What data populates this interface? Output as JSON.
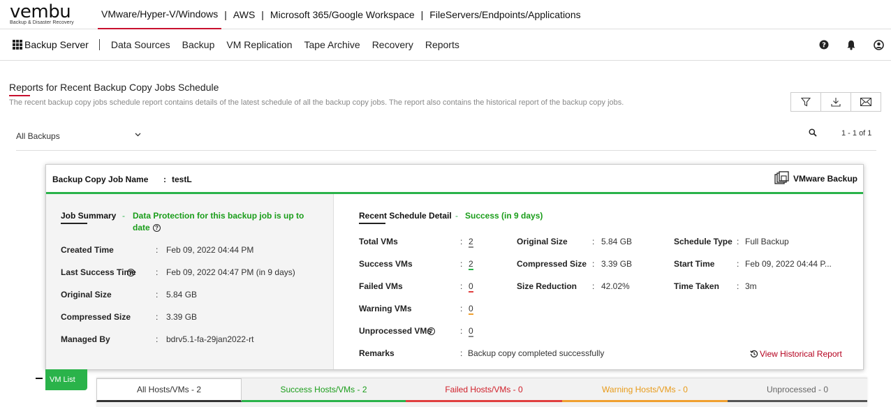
{
  "brand": {
    "name": "vembu",
    "tagline": "Backup & Disaster Recovery"
  },
  "product_tabs": [
    "VMware/Hyper-V/Windows",
    "AWS",
    "Microsoft 365/Google Workspace",
    "FileServers/Endpoints/Applications"
  ],
  "product_separator": "|",
  "nav": {
    "server": "Backup Server",
    "items": [
      "Data Sources",
      "Backup",
      "VM Replication",
      "Tape Archive",
      "Recovery",
      "Reports"
    ]
  },
  "page": {
    "title": "Reports for Recent Backup Copy Jobs Schedule",
    "description": "The recent backup copy jobs schedule report contains details of the latest schedule of all the backup copy jobs. The report also contains the historical report of the backup copy jobs."
  },
  "filter": {
    "selected": "All Backups",
    "paging": "1 - 1 of 1"
  },
  "job": {
    "name_label": "Backup Copy Job Name",
    "name_colon": ":",
    "name_value": "testL",
    "type": "VMware Backup"
  },
  "summary": {
    "title": "Job Summary",
    "dash": "-",
    "status_line1": "Data Protection for this backup job is up to",
    "status_line2": "date",
    "colon": ":",
    "rows": [
      {
        "label": "Created Time",
        "value": "Feb 09, 2022 04:44 PM"
      },
      {
        "label": "Last Success Time",
        "value": "Feb 09, 2022 04:47 PM (in 9 days)"
      },
      {
        "label": "Original Size",
        "value": "5.84 GB"
      },
      {
        "label": "Compressed Size",
        "value": "3.39 GB"
      },
      {
        "label": "Managed By",
        "value": "bdrv5.1-fa-29jan2022-rt"
      }
    ]
  },
  "schedule": {
    "title": "Recent Schedule Detail",
    "dash": "-",
    "status": "Success  (in 9 days)",
    "colon": ":",
    "vm_counts": [
      {
        "label": "Total VMs",
        "value": "2"
      },
      {
        "label": "Success VMs",
        "value": "2"
      },
      {
        "label": "Failed VMs",
        "value": "0"
      },
      {
        "label": "Warning VMs",
        "value": "0"
      },
      {
        "label": "Unprocessed VMs",
        "value": "0"
      }
    ],
    "sizes": [
      {
        "label": "Original Size",
        "value": "5.84 GB"
      },
      {
        "label": "Compressed Size",
        "value": "3.39 GB"
      },
      {
        "label": "Size Reduction",
        "value": "42.02%"
      }
    ],
    "meta": [
      {
        "label": "Schedule Type",
        "value": "Full Backup"
      },
      {
        "label": "Start Time",
        "value": "Feb 09, 2022 04:44 P..."
      },
      {
        "label": "Time Taken",
        "value": "3m"
      }
    ],
    "remarks_label": "Remarks",
    "remarks_value": "Backup copy completed successfully",
    "history_link": "View Historical Report"
  },
  "vm_list": {
    "tab": "VM List",
    "host_tabs": [
      "All Hosts/VMs  -  2",
      "Success Hosts/VMs  -  2",
      "Failed Hosts/VMs  -  0",
      "Warning Hosts/VMs  -  0",
      "Unprocessed  -  0"
    ]
  },
  "colors": {
    "accent_red": "#c8102e",
    "success_green": "#2ab34a",
    "failed_red": "#e04040",
    "warning_orange": "#f0a030",
    "link_red": "#b4001e"
  },
  "icons": [
    "grid-icon",
    "help-icon",
    "bell-icon",
    "user-icon",
    "filter-icon",
    "download-icon",
    "mail-icon",
    "chevron-down-icon",
    "search-icon",
    "vmware-icon",
    "info-icon",
    "history-icon"
  ]
}
